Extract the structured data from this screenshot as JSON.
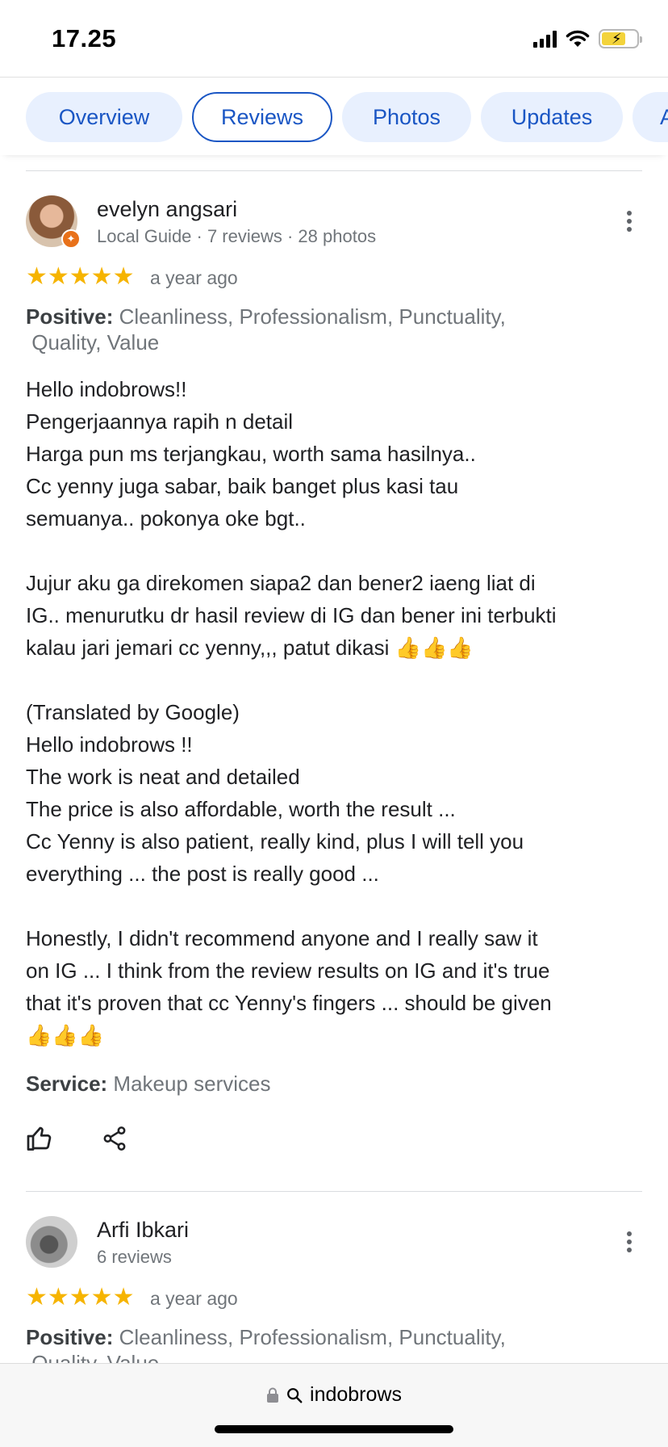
{
  "status_bar": {
    "time": "17.25"
  },
  "tabs": [
    {
      "label": "Overview",
      "active": false
    },
    {
      "label": "Reviews",
      "active": true
    },
    {
      "label": "Photos",
      "active": false
    },
    {
      "label": "Updates",
      "active": false
    },
    {
      "label": "A",
      "active": false
    }
  ],
  "reviews": [
    {
      "name": "evelyn angsari",
      "meta": "Local Guide · 7 reviews · 28 photos",
      "rating": 5,
      "stars": "★★★★★",
      "date": "a year ago",
      "positive_label": "Positive:",
      "positive_value": " Cleanliness, Professionalism, Punctuality,\n Quality, Value",
      "text": "Hello indobrows!!\nPengerjaannya rapih n detail\nHarga pun ms terjangkau, worth sama hasilnya..\nCc yenny juga sabar, baik banget plus kasi tau\nsemuanya.. pokonya oke bgt..\n\nJujur aku ga direkomen siapa2 dan bener2 iaeng liat di\nIG.. menurutku dr hasil review di IG dan bener ini terbukti\nkalau jari jemari cc yenny,,, patut dikasi 👍👍👍\n\n(Translated by Google)\nHello indobrows !!\nThe work is neat and detailed\nThe price is also affordable, worth the result ...\nCc Yenny is also patient, really kind, plus I will tell you\neverything ... the post is really good ...\n\nHonestly, I didn't recommend anyone and I really saw it\non IG ... I think from the review results on IG and it's true\nthat it's proven that cc Yenny's fingers ... should be given\n👍👍👍",
      "service_label": "Service:",
      "service_value": " Makeup services"
    },
    {
      "name": "Arfi Ibkari",
      "meta": "6 reviews",
      "rating": 5,
      "stars": "★★★★★",
      "date": "a year ago",
      "positive_label": "Positive:",
      "positive_value": " Cleanliness, Professionalism, Punctuality,\n Quality, Value"
    }
  ],
  "bottom_bar": {
    "url": "indobrows"
  },
  "icons": {
    "like": "thumbs-up-icon",
    "share": "share-icon",
    "more": "more-vert-icon",
    "lock": "lock-icon",
    "search": "search-icon",
    "local_guide": "local-guide-badge-icon"
  },
  "colors": {
    "accent": "#1a56c4",
    "tab_bg": "#e8f0fe",
    "star": "#f6b400",
    "battery": "#f3d33b"
  }
}
